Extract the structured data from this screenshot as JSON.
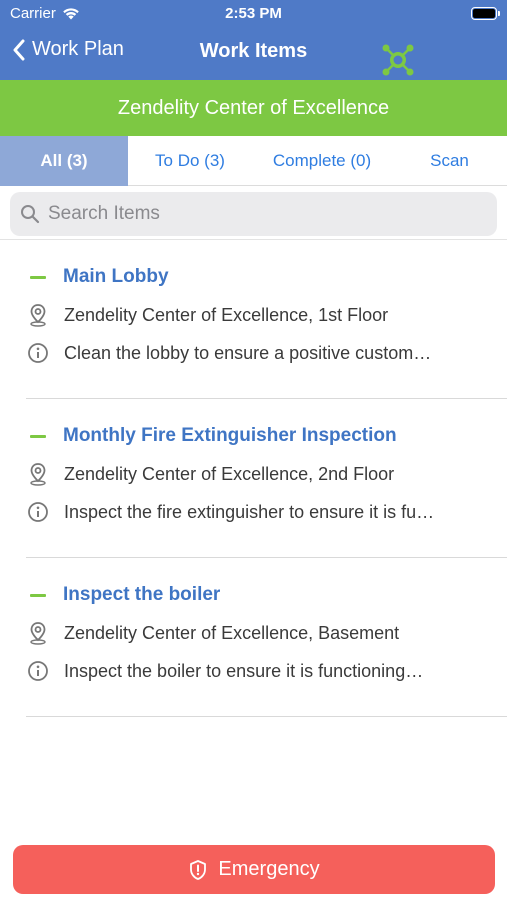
{
  "status_bar": {
    "carrier": "Carrier",
    "time": "2:53 PM"
  },
  "nav": {
    "back_label": "Work Plan",
    "title": "Work Items",
    "logo_icon": "zendelity-network-logo"
  },
  "banner": {
    "text": "Zendelity Center of Excellence",
    "color": "#7dc843"
  },
  "tabs": [
    {
      "label": "All (3)",
      "active": true
    },
    {
      "label": "To Do (3)",
      "active": false
    },
    {
      "label": "Complete (0)",
      "active": false
    },
    {
      "label": "Scan",
      "active": false
    }
  ],
  "search": {
    "placeholder": "Search Items",
    "value": ""
  },
  "items": [
    {
      "title": "Main Lobby",
      "location": "Zendelity Center of Excellence, 1st Floor",
      "description": "Clean the lobby to ensure a positive custom…"
    },
    {
      "title": "Monthly Fire Extinguisher Inspection",
      "location": "Zendelity Center of Excellence, 2nd Floor",
      "description": "Inspect the fire extinguisher to ensure it is fu…"
    },
    {
      "title": "Inspect the boiler",
      "location": "Zendelity Center of Excellence, Basement",
      "description": "Inspect the boiler to ensure it is functioning…"
    }
  ],
  "emergency": {
    "label": "Emergency",
    "icon": "shield-alert-icon",
    "color": "#f5605b"
  },
  "colors": {
    "header": "#4f7ac7",
    "accent_blue": "#3f75c4",
    "active_tab": "#8ea8d7"
  }
}
